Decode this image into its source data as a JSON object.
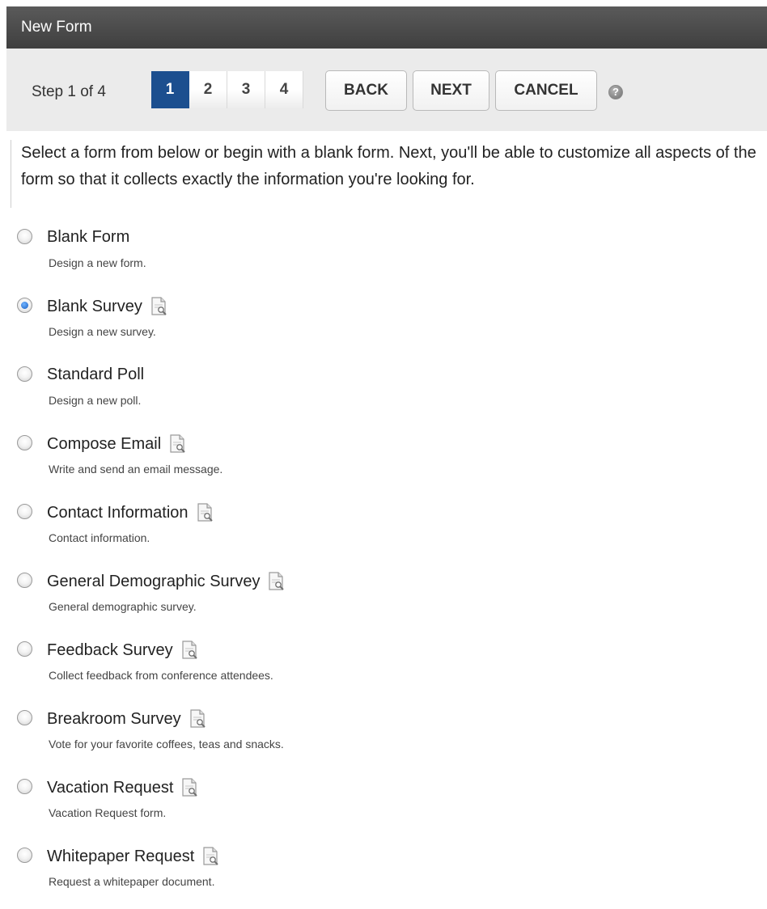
{
  "window": {
    "title": "New Form"
  },
  "toolbar": {
    "step_label": "Step 1 of 4",
    "steps": [
      "1",
      "2",
      "3",
      "4"
    ],
    "active_step": "1",
    "back_label": "BACK",
    "next_label": "NEXT",
    "cancel_label": "CANCEL",
    "help_glyph": "?"
  },
  "intro": {
    "text": "Select a form from below or begin with a blank form. Next, you'll be able to customize all aspects of the form so that it collects exactly the information you're looking for."
  },
  "options": [
    {
      "title": "Blank Form",
      "description": "Design a new form.",
      "selected": false,
      "has_preview": false
    },
    {
      "title": "Blank Survey",
      "description": "Design a new survey.",
      "selected": true,
      "has_preview": true
    },
    {
      "title": "Standard Poll",
      "description": "Design a new poll.",
      "selected": false,
      "has_preview": false
    },
    {
      "title": "Compose Email",
      "description": "Write and send an email message.",
      "selected": false,
      "has_preview": true
    },
    {
      "title": "Contact Information",
      "description": "Contact information.",
      "selected": false,
      "has_preview": true
    },
    {
      "title": "General Demographic Survey",
      "description": "General demographic survey.",
      "selected": false,
      "has_preview": true
    },
    {
      "title": "Feedback Survey",
      "description": "Collect feedback from conference attendees.",
      "selected": false,
      "has_preview": true
    },
    {
      "title": "Breakroom Survey",
      "description": "Vote for your favorite coffees, teas and snacks.",
      "selected": false,
      "has_preview": true
    },
    {
      "title": "Vacation Request",
      "description": "Vacation Request form.",
      "selected": false,
      "has_preview": true
    },
    {
      "title": "Whitepaper Request",
      "description": "Request a whitepaper document.",
      "selected": false,
      "has_preview": true
    }
  ],
  "icons": {
    "preview": "document-preview-icon",
    "help": "help-icon"
  },
  "colors": {
    "titlebar": "#4a4a4a",
    "active_step": "#1c4f8f",
    "toolbar_bg": "#ebebeb"
  }
}
